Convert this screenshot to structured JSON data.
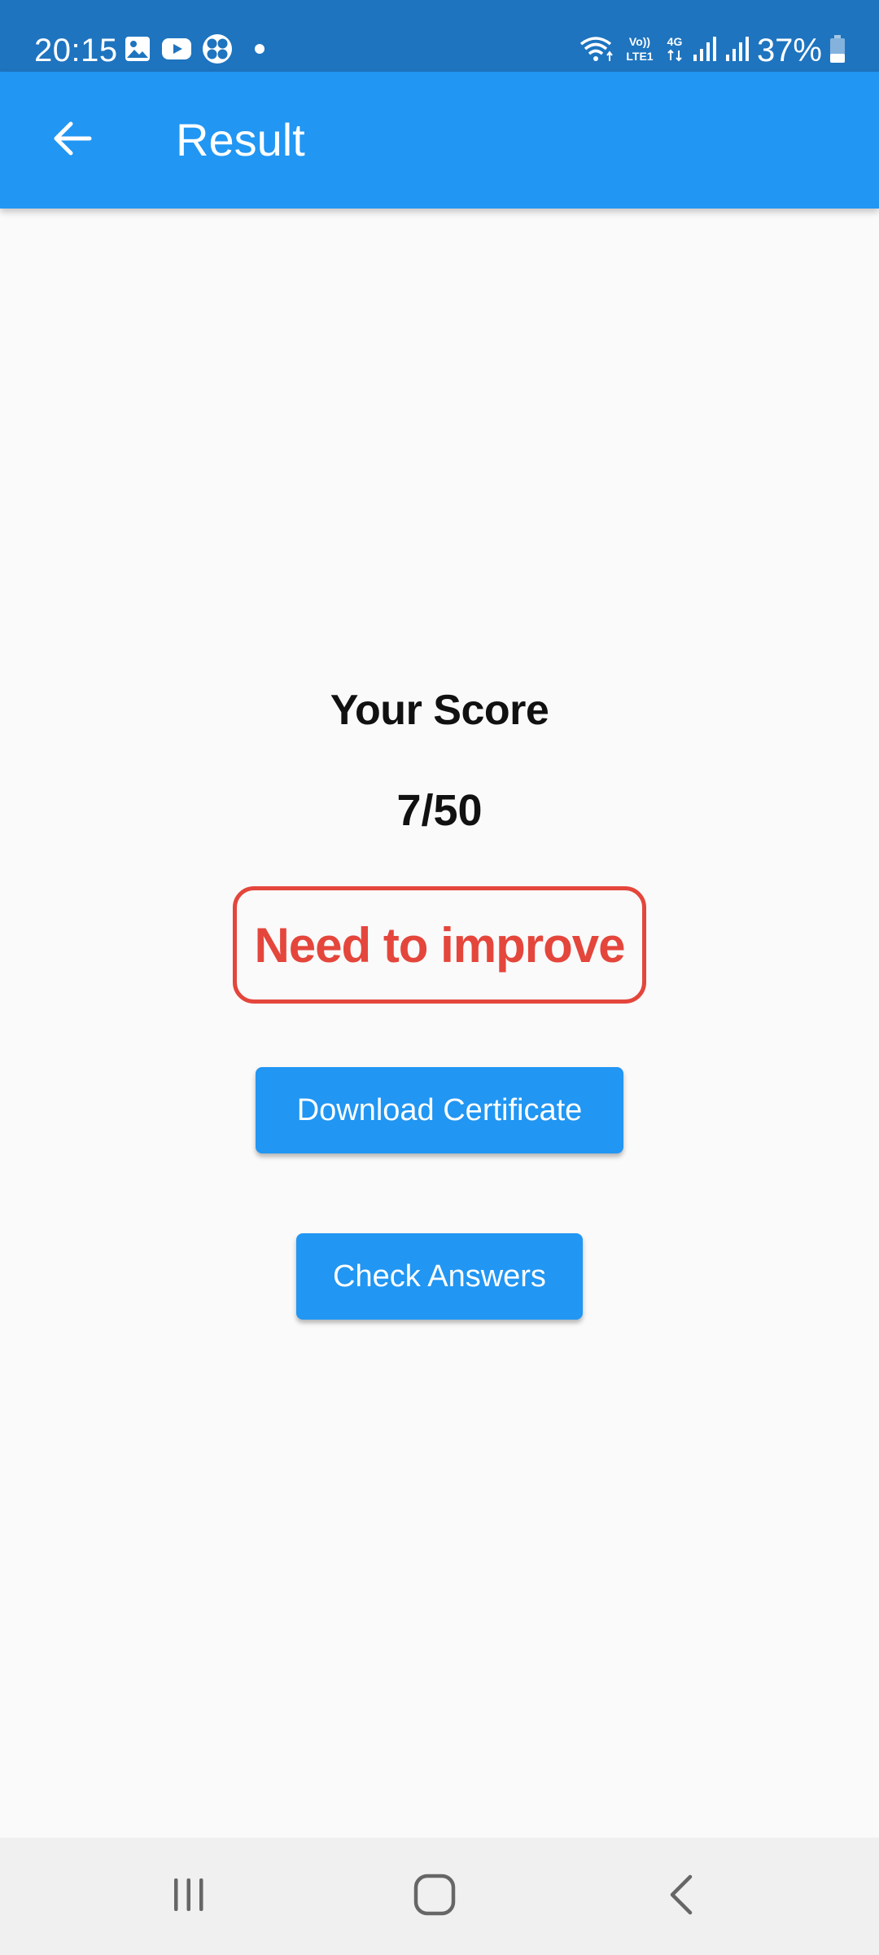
{
  "status_bar": {
    "time": "20:15",
    "battery_percent": "37%",
    "background_color": "#1e74bf",
    "left_icons": [
      "gallery-icon",
      "youtube-icon",
      "fan-app-icon",
      "notification-dot-icon"
    ],
    "right_icons": [
      "wifi-icon",
      "volte-icon",
      "4g-icon",
      "signal-sim1-icon",
      "signal-sim2-icon",
      "battery-icon"
    ],
    "volte_label": "Vo))\nLTE1",
    "network_label": "4G",
    "battery_level": 0.37
  },
  "app_bar": {
    "title": "Result",
    "back_icon": "arrow-back-icon",
    "background_color": "#2196f3"
  },
  "result": {
    "score_label": "Your Score",
    "score_value": "7/50",
    "feedback": "Need to improve",
    "feedback_color": "#e4463c"
  },
  "actions": {
    "download_certificate_label": "Download Certificate",
    "check_answers_label": "Check Answers",
    "button_color": "#2196f3"
  },
  "nav_bar": {
    "recents_icon": "recents-icon",
    "home_icon": "home-icon",
    "back_icon": "back-chevron-icon"
  }
}
